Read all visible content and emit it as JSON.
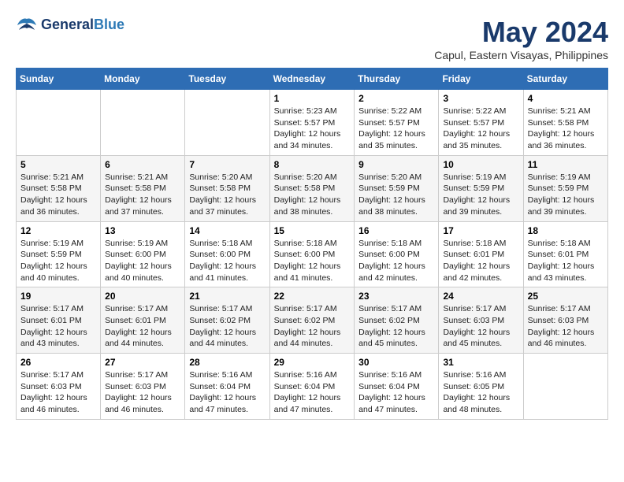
{
  "logo": {
    "line1": "General",
    "line2": "Blue"
  },
  "title": "May 2024",
  "location": "Capul, Eastern Visayas, Philippines",
  "days_of_week": [
    "Sunday",
    "Monday",
    "Tuesday",
    "Wednesday",
    "Thursday",
    "Friday",
    "Saturday"
  ],
  "weeks": [
    [
      {
        "day": "",
        "info": ""
      },
      {
        "day": "",
        "info": ""
      },
      {
        "day": "",
        "info": ""
      },
      {
        "day": "1",
        "info": "Sunrise: 5:23 AM\nSunset: 5:57 PM\nDaylight: 12 hours\nand 34 minutes."
      },
      {
        "day": "2",
        "info": "Sunrise: 5:22 AM\nSunset: 5:57 PM\nDaylight: 12 hours\nand 35 minutes."
      },
      {
        "day": "3",
        "info": "Sunrise: 5:22 AM\nSunset: 5:57 PM\nDaylight: 12 hours\nand 35 minutes."
      },
      {
        "day": "4",
        "info": "Sunrise: 5:21 AM\nSunset: 5:58 PM\nDaylight: 12 hours\nand 36 minutes."
      }
    ],
    [
      {
        "day": "5",
        "info": "Sunrise: 5:21 AM\nSunset: 5:58 PM\nDaylight: 12 hours\nand 36 minutes."
      },
      {
        "day": "6",
        "info": "Sunrise: 5:21 AM\nSunset: 5:58 PM\nDaylight: 12 hours\nand 37 minutes."
      },
      {
        "day": "7",
        "info": "Sunrise: 5:20 AM\nSunset: 5:58 PM\nDaylight: 12 hours\nand 37 minutes."
      },
      {
        "day": "8",
        "info": "Sunrise: 5:20 AM\nSunset: 5:58 PM\nDaylight: 12 hours\nand 38 minutes."
      },
      {
        "day": "9",
        "info": "Sunrise: 5:20 AM\nSunset: 5:59 PM\nDaylight: 12 hours\nand 38 minutes."
      },
      {
        "day": "10",
        "info": "Sunrise: 5:19 AM\nSunset: 5:59 PM\nDaylight: 12 hours\nand 39 minutes."
      },
      {
        "day": "11",
        "info": "Sunrise: 5:19 AM\nSunset: 5:59 PM\nDaylight: 12 hours\nand 39 minutes."
      }
    ],
    [
      {
        "day": "12",
        "info": "Sunrise: 5:19 AM\nSunset: 5:59 PM\nDaylight: 12 hours\nand 40 minutes."
      },
      {
        "day": "13",
        "info": "Sunrise: 5:19 AM\nSunset: 6:00 PM\nDaylight: 12 hours\nand 40 minutes."
      },
      {
        "day": "14",
        "info": "Sunrise: 5:18 AM\nSunset: 6:00 PM\nDaylight: 12 hours\nand 41 minutes."
      },
      {
        "day": "15",
        "info": "Sunrise: 5:18 AM\nSunset: 6:00 PM\nDaylight: 12 hours\nand 41 minutes."
      },
      {
        "day": "16",
        "info": "Sunrise: 5:18 AM\nSunset: 6:00 PM\nDaylight: 12 hours\nand 42 minutes."
      },
      {
        "day": "17",
        "info": "Sunrise: 5:18 AM\nSunset: 6:01 PM\nDaylight: 12 hours\nand 42 minutes."
      },
      {
        "day": "18",
        "info": "Sunrise: 5:18 AM\nSunset: 6:01 PM\nDaylight: 12 hours\nand 43 minutes."
      }
    ],
    [
      {
        "day": "19",
        "info": "Sunrise: 5:17 AM\nSunset: 6:01 PM\nDaylight: 12 hours\nand 43 minutes."
      },
      {
        "day": "20",
        "info": "Sunrise: 5:17 AM\nSunset: 6:01 PM\nDaylight: 12 hours\nand 44 minutes."
      },
      {
        "day": "21",
        "info": "Sunrise: 5:17 AM\nSunset: 6:02 PM\nDaylight: 12 hours\nand 44 minutes."
      },
      {
        "day": "22",
        "info": "Sunrise: 5:17 AM\nSunset: 6:02 PM\nDaylight: 12 hours\nand 44 minutes."
      },
      {
        "day": "23",
        "info": "Sunrise: 5:17 AM\nSunset: 6:02 PM\nDaylight: 12 hours\nand 45 minutes."
      },
      {
        "day": "24",
        "info": "Sunrise: 5:17 AM\nSunset: 6:03 PM\nDaylight: 12 hours\nand 45 minutes."
      },
      {
        "day": "25",
        "info": "Sunrise: 5:17 AM\nSunset: 6:03 PM\nDaylight: 12 hours\nand 46 minutes."
      }
    ],
    [
      {
        "day": "26",
        "info": "Sunrise: 5:17 AM\nSunset: 6:03 PM\nDaylight: 12 hours\nand 46 minutes."
      },
      {
        "day": "27",
        "info": "Sunrise: 5:17 AM\nSunset: 6:03 PM\nDaylight: 12 hours\nand 46 minutes."
      },
      {
        "day": "28",
        "info": "Sunrise: 5:16 AM\nSunset: 6:04 PM\nDaylight: 12 hours\nand 47 minutes."
      },
      {
        "day": "29",
        "info": "Sunrise: 5:16 AM\nSunset: 6:04 PM\nDaylight: 12 hours\nand 47 minutes."
      },
      {
        "day": "30",
        "info": "Sunrise: 5:16 AM\nSunset: 6:04 PM\nDaylight: 12 hours\nand 47 minutes."
      },
      {
        "day": "31",
        "info": "Sunrise: 5:16 AM\nSunset: 6:05 PM\nDaylight: 12 hours\nand 48 minutes."
      },
      {
        "day": "",
        "info": ""
      }
    ]
  ]
}
